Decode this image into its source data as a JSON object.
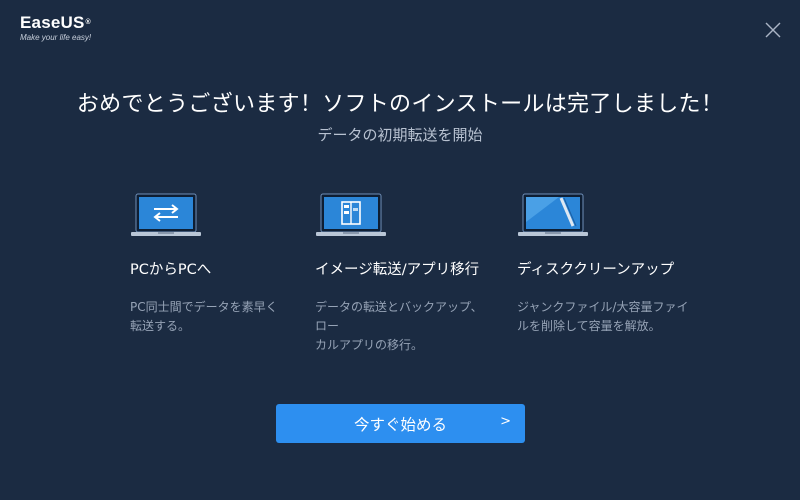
{
  "brand": {
    "name": "EaseUS",
    "registered": "®",
    "tagline": "Make your life easy!"
  },
  "header": {
    "title": "おめでとうございます！ソフトのインストールは完了しました！",
    "subtitle": "データの初期転送を開始"
  },
  "features": [
    {
      "icon": "laptop-transfer-icon",
      "title": "PCからPCへ",
      "description_line1": "PC同士間でデータを素早く",
      "description_line2": "転送する。"
    },
    {
      "icon": "laptop-backup-icon",
      "title": "イメージ転送/アプリ移行",
      "description_line1": "データの転送とバックアップ、ロー",
      "description_line2": "カルアプリの移行。"
    },
    {
      "icon": "laptop-cleanup-icon",
      "title": "ディスククリーンアップ",
      "description_line1": "ジャンクファイル/大容量ファイ",
      "description_line2": "ルを削除して容量を解放。"
    }
  ],
  "start_button": {
    "label": "今すぐ始める",
    "arrow": ">"
  },
  "colors": {
    "background": "#1b2b42",
    "accent": "#2d8ff0"
  }
}
